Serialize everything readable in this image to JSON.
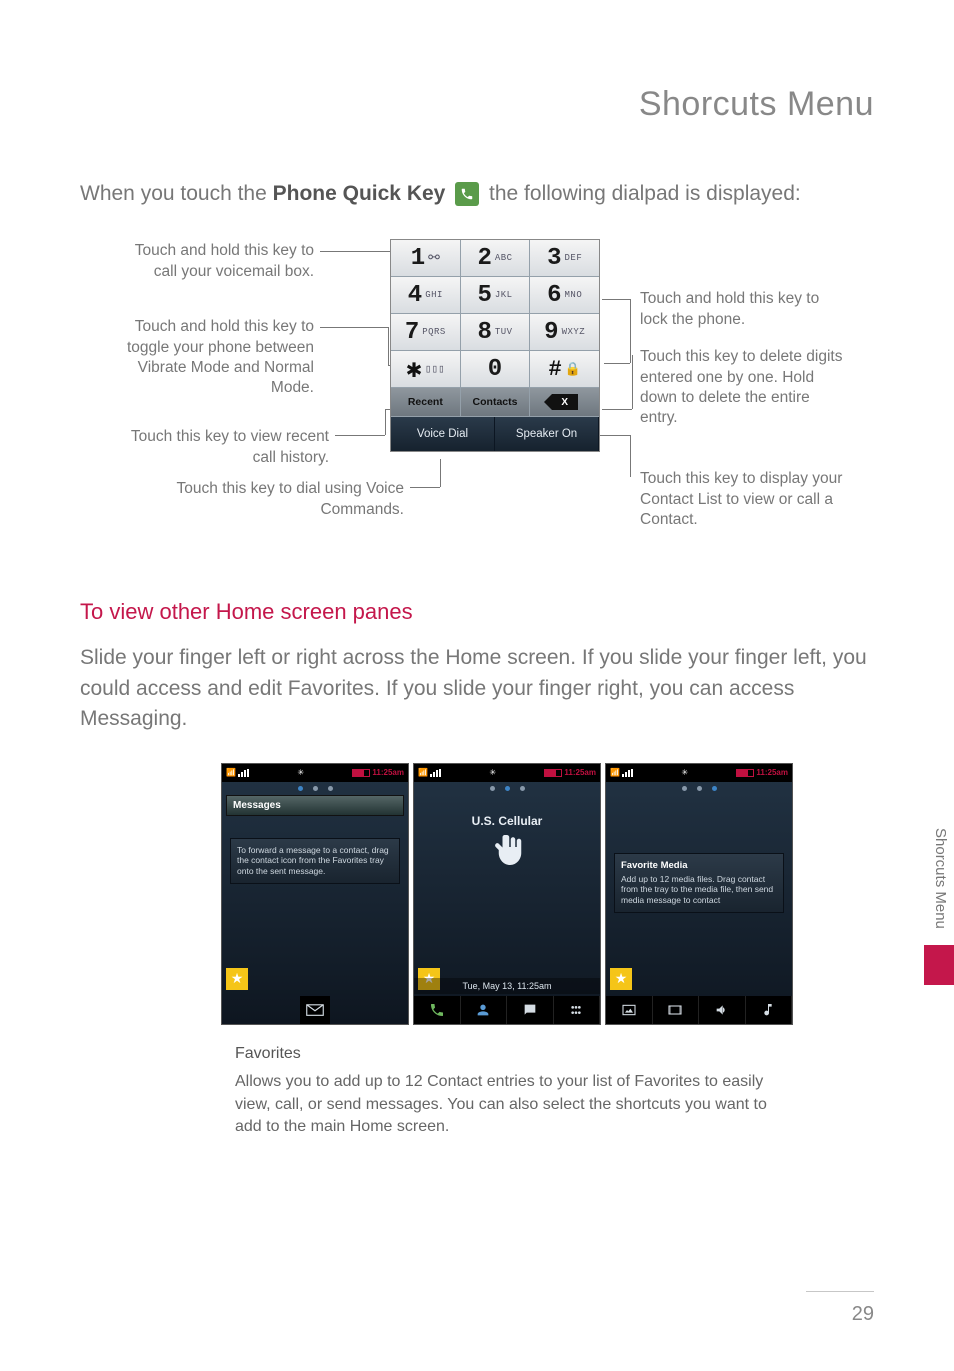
{
  "page_title": "Shorcuts Menu",
  "side_tab": "Shorcuts Menu",
  "page_number": "29",
  "intro": {
    "prefix": "When you touch the ",
    "bold": "Phone Quick Key",
    "suffix": " the following dialpad is displayed:"
  },
  "dialpad": {
    "keys": [
      {
        "num": "1",
        "let": "",
        "icon": "voicemail"
      },
      {
        "num": "2",
        "let": "ABC"
      },
      {
        "num": "3",
        "let": "DEF"
      },
      {
        "num": "4",
        "let": "GHI"
      },
      {
        "num": "5",
        "let": "JKL"
      },
      {
        "num": "6",
        "let": "MNO"
      },
      {
        "num": "7",
        "let": "PQRS"
      },
      {
        "num": "8",
        "let": "TUV"
      },
      {
        "num": "9",
        "let": "WXYZ"
      },
      {
        "sym": "star",
        "icon": "vibrate"
      },
      {
        "num": "0",
        "let": ""
      },
      {
        "sym": "hash",
        "icon": "lock"
      }
    ],
    "func_row": [
      "Recent",
      "Contacts"
    ],
    "bottom_row": [
      "Voice Dial",
      "Speaker On"
    ]
  },
  "callouts": {
    "l1": "Touch and hold this key to call your voicemail box.",
    "l2": "Touch and hold this key to toggle your phone between Vibrate Mode and Normal Mode.",
    "l3": "Touch this key to view recent call history.",
    "l4": "Touch this key to dial using Voice Commands.",
    "r1": "Touch and hold this key to lock the phone.",
    "r2": "Touch this key to delete digits entered one by one. Hold down to delete the entire entry.",
    "r3": "Touch this key to display your Contact List to view or call a Contact."
  },
  "section_heading": "To view other Home screen panes",
  "body_text": "Slide your finger left or right across the Home screen. If you slide your finger left, you could access and edit Favorites. If you slide your finger right, you can access Messaging.",
  "screens": {
    "status_time": "11:25am",
    "messages_bar": "Messages",
    "tip_left": "To forward a message to a contact, drag the contact icon from the Favorites tray onto the sent message.",
    "carrier": "U.S. Cellular",
    "date_line": "Tue, May 13, 11:25am",
    "fav_title": "Favorite Media",
    "fav_body": "Add up to 12 media files. Drag contact from the tray to the media file, then send media message to contact"
  },
  "caption": {
    "title": "Favorites",
    "body": "Allows you to add up to 12 Contact entries to your list of Favorites to easily view, call, or send messages. You can also select the shortcuts you want to add to the main Home screen."
  }
}
